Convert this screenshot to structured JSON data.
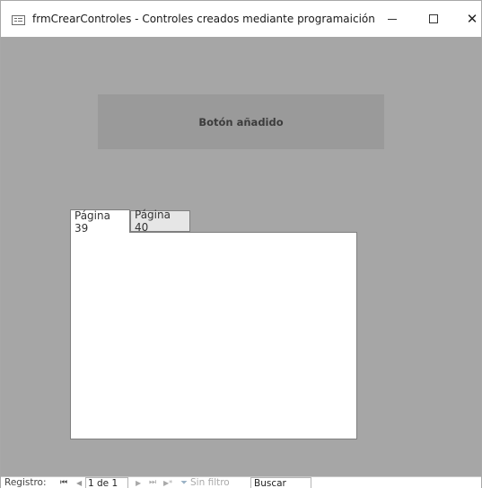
{
  "window": {
    "title": "frmCrearControles - Controles creados mediante programaición",
    "minimize_glyph": "—",
    "close_glyph": "✕"
  },
  "form": {
    "button_label": "Botón añadido",
    "tabs": [
      {
        "label": "Página 39",
        "selected": true
      },
      {
        "label": "Página 40",
        "selected": false
      }
    ]
  },
  "navbar": {
    "label": "Registro:",
    "first_glyph": "⏮",
    "prev_glyph": "◀",
    "current": "1 de 1",
    "next_glyph": "▶",
    "last_glyph": "⏭",
    "new_glyph": "▶*",
    "filter_icon": "filter-icon",
    "filter_label": "Sin filtro",
    "search_placeholder": "Buscar"
  },
  "colors": {
    "form_background": "#a6a6a6",
    "button_background": "#9a9a9a",
    "tab_page_background": "#ffffff"
  }
}
